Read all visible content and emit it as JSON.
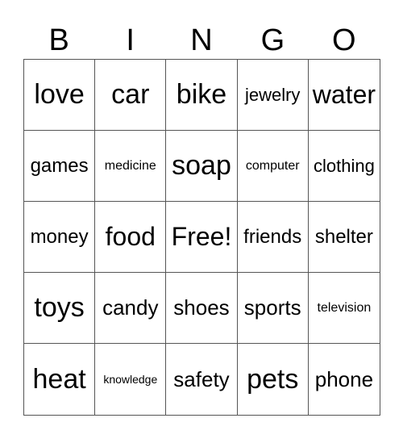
{
  "header": [
    "B",
    "I",
    "N",
    "G",
    "O"
  ],
  "cells": [
    "love",
    "car",
    "bike",
    "jewelry",
    "water",
    "games",
    "medicine",
    "soap",
    "computer",
    "clothing",
    "money",
    "food",
    "Free!",
    "friends",
    "shelter",
    "toys",
    "candy",
    "shoes",
    "sports",
    "television",
    "heat",
    "knowledge",
    "safety",
    "pets",
    "phone"
  ]
}
